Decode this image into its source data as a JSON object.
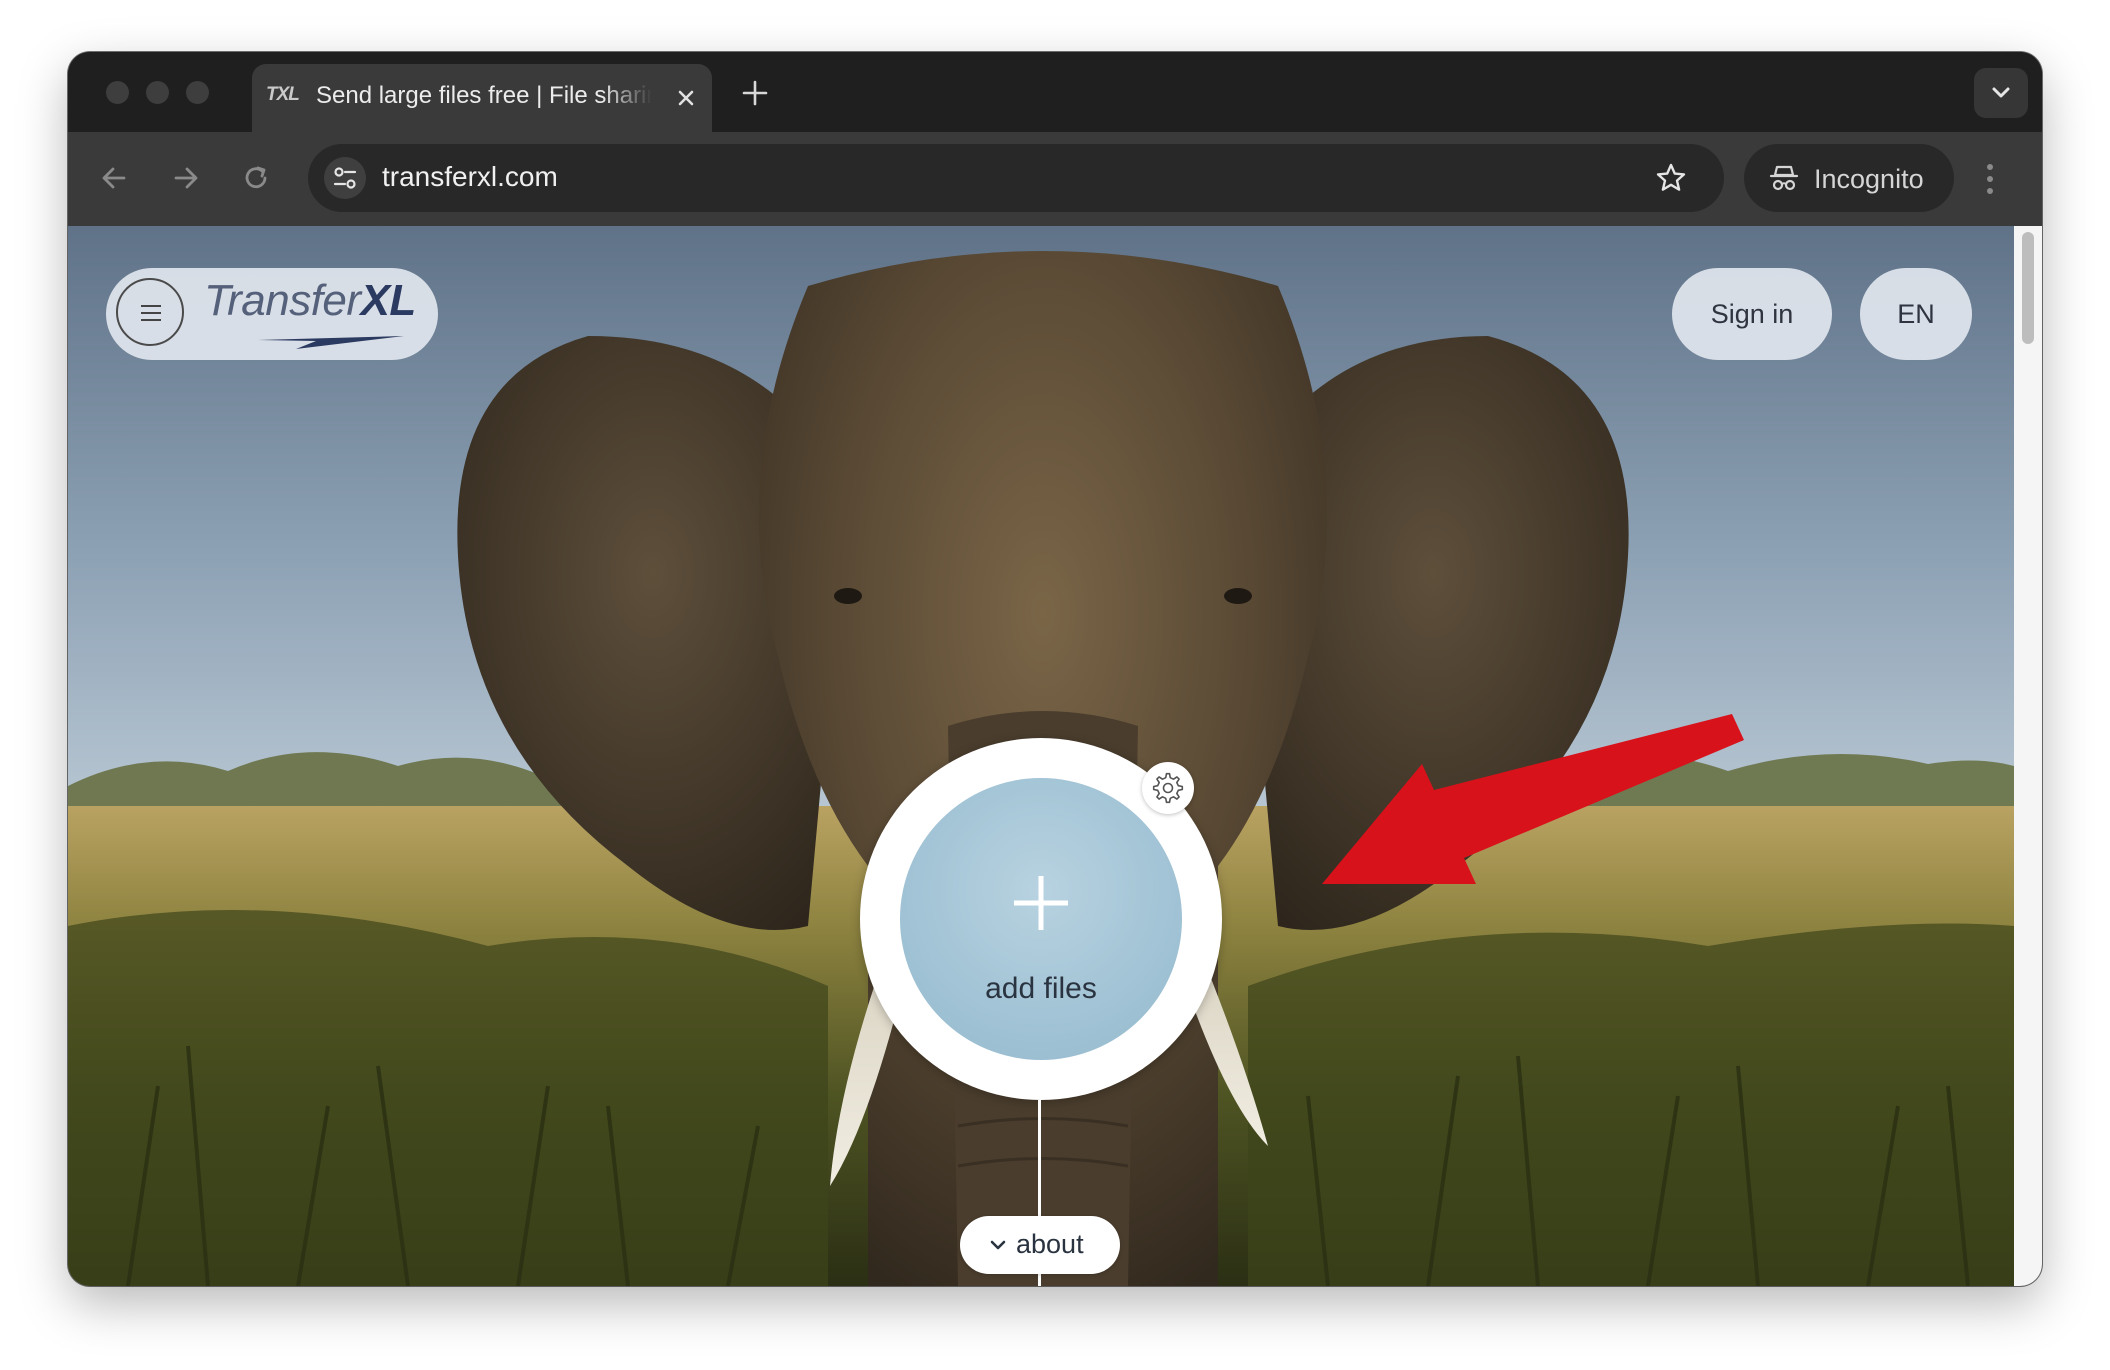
{
  "browser": {
    "tab": {
      "favicon_text": "TXL",
      "title": "Send large files free | File sharing"
    },
    "address_bar": {
      "url": "transferxl.com"
    },
    "profile": {
      "label": "Incognito"
    }
  },
  "page": {
    "logo": {
      "regular": "Transfer",
      "bold": "XL"
    },
    "header": {
      "sign_in_label": "Sign in",
      "language_label": "EN"
    },
    "upload": {
      "label": "add files"
    },
    "about": {
      "label": "about"
    }
  },
  "colors": {
    "annotation_arrow": "#d8121b",
    "upload_circle": "#a1c3d5"
  },
  "icons": {
    "menu": "hamburger-icon",
    "settings": "gear-icon",
    "add": "plus-icon",
    "expand": "chevron-down-icon"
  }
}
